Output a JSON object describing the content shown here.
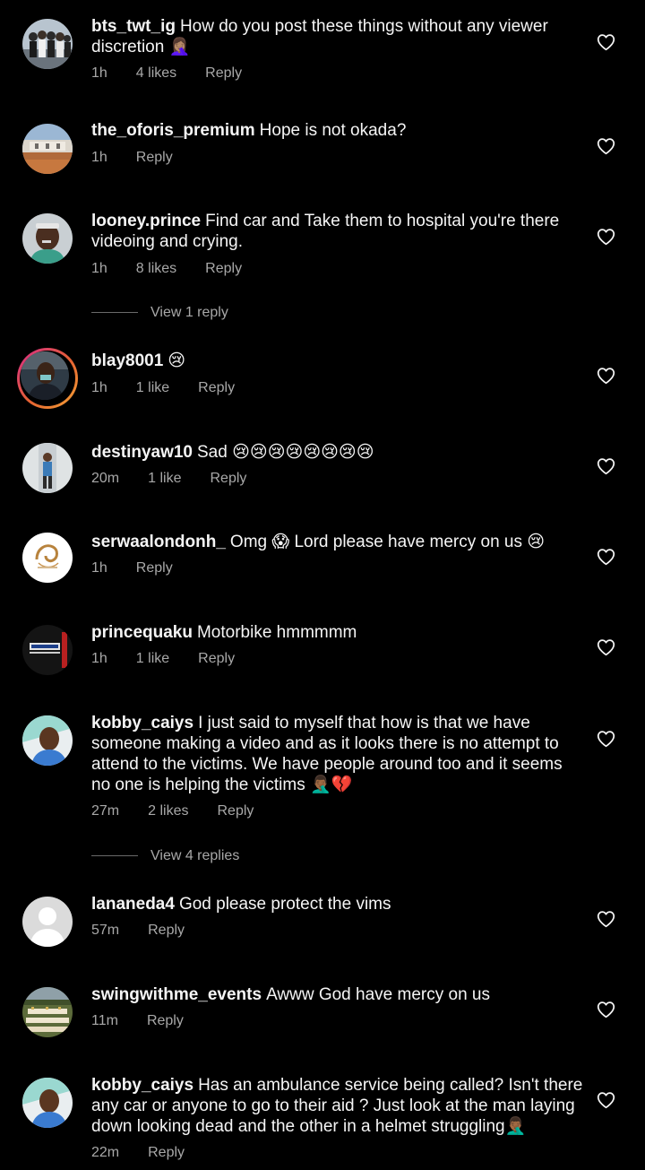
{
  "comments": [
    {
      "username": "bts_twt_ig",
      "text": "How do you post these things without any viewer discretion 🤦🏽‍♀️",
      "time": "1h",
      "likes": "4 likes",
      "reply": "Reply"
    },
    {
      "username": "the_oforis_premium",
      "text": "Hope is not okada?",
      "time": "1h",
      "likes": "",
      "reply": "Reply"
    },
    {
      "username": "looney.prince",
      "text": "Find car and Take them to hospital you're there videoing and crying.",
      "time": "1h",
      "likes": "8 likes",
      "reply": "Reply"
    },
    {
      "username": "blay8001",
      "text": "😢",
      "time": "1h",
      "likes": "1 like",
      "reply": "Reply"
    },
    {
      "username": "destinyaw10",
      "text": "Sad 😢😢😢😢😢😢😢😢",
      "time": "20m",
      "likes": "1 like",
      "reply": "Reply"
    },
    {
      "username": "serwaalondonh_",
      "text": "Omg 😱 Lord please have mercy on us 😢",
      "time": "1h",
      "likes": "",
      "reply": "Reply"
    },
    {
      "username": "princequaku",
      "text": "Motorbike hmmmmm",
      "time": "1h",
      "likes": "1 like",
      "reply": "Reply"
    },
    {
      "username": "kobby_caiys",
      "text": "I just said to myself that how is that we have someone making a video and as it looks there is no attempt to attend to the victims. We have people around too and it seems no one is helping the victims 🤦🏾‍♂️💔",
      "time": "27m",
      "likes": "2 likes",
      "reply": "Reply"
    },
    {
      "username": "lananeda4",
      "text": "God please protect the vims",
      "time": "57m",
      "likes": "",
      "reply": "Reply"
    },
    {
      "username": "swingwithme_events",
      "text": "Awww God have mercy on us",
      "time": "11m",
      "likes": "",
      "reply": "Reply"
    },
    {
      "username": "kobby_caiys",
      "text": "Has an ambulance service being called? Isn't there any car or anyone to go to their aid ? Just look at the man laying down looking dead and the other in a helmet struggling🤦🏾‍♂️",
      "time": "22m",
      "likes": "",
      "reply": "Reply"
    }
  ],
  "view_replies": {
    "looney": "View 1 reply",
    "kobby": "View 4 replies"
  },
  "icons": {
    "like": "heart-outline-icon"
  },
  "colors": {
    "background": "#000000",
    "text": "#f5f5f5",
    "secondary": "#a8a8a8",
    "story_ring_start": "#d52a88",
    "story_ring_end": "#f4a435"
  }
}
